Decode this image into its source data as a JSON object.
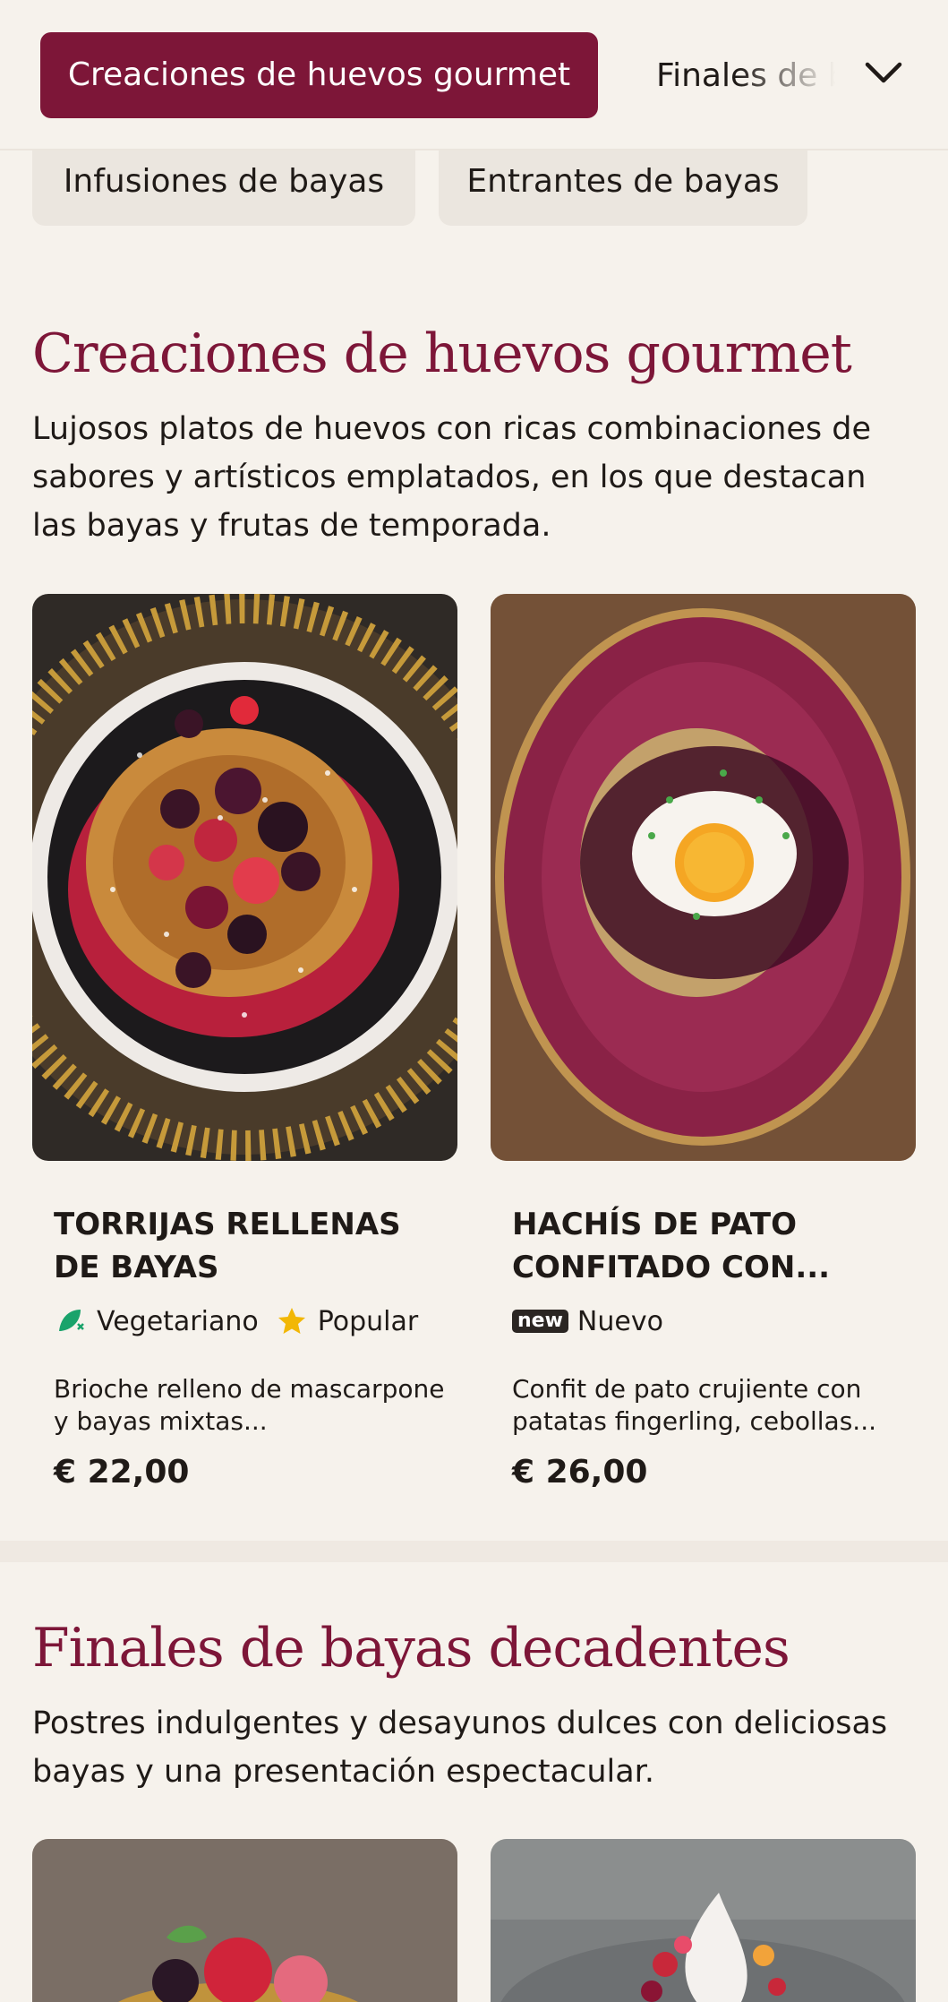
{
  "nav": {
    "active_category": "Creaciones de huevos gourmet",
    "next_category": "Finales de bayas decadentes",
    "next_category_visible": "Finales de b",
    "pills": [
      "Infusiones de bayas",
      "Entrantes de bayas"
    ]
  },
  "sections": [
    {
      "title": "Creaciones de huevos gourmet",
      "description": "Lujosos platos de huevos con ricas combinaciones de sabores y artísticos emplatados, en los que destacan las bayas y frutas de temporada.",
      "items": [
        {
          "name": "TORRIJAS RELLENAS DE BAYAS",
          "tags": [
            {
              "icon": "vegetarian-icon",
              "label": "Vegetariano"
            },
            {
              "icon": "star-icon",
              "label": "Popular"
            }
          ],
          "description": "Brioche relleno de mascarpone y bayas mixtas...",
          "price": "€ 22,00"
        },
        {
          "name": "HACHÍS DE PATO CONFITADO CON...",
          "tags": [
            {
              "icon": "new-badge-icon",
              "badge": "new",
              "label": "Nuevo"
            }
          ],
          "description": "Confit de pato crujiente con patatas fingerling, cebollas...",
          "price": "€ 26,00"
        }
      ]
    },
    {
      "title": "Finales de bayas decadentes",
      "description": "Postres indulgentes y desayunos dulces con deliciosas bayas y una presentación espectacular."
    }
  ],
  "colors": {
    "accent": "#7d1638",
    "background": "#f6f2ec",
    "pill": "#ebe6df",
    "vegetarian": "#1aa36b",
    "star": "#f2b705"
  }
}
